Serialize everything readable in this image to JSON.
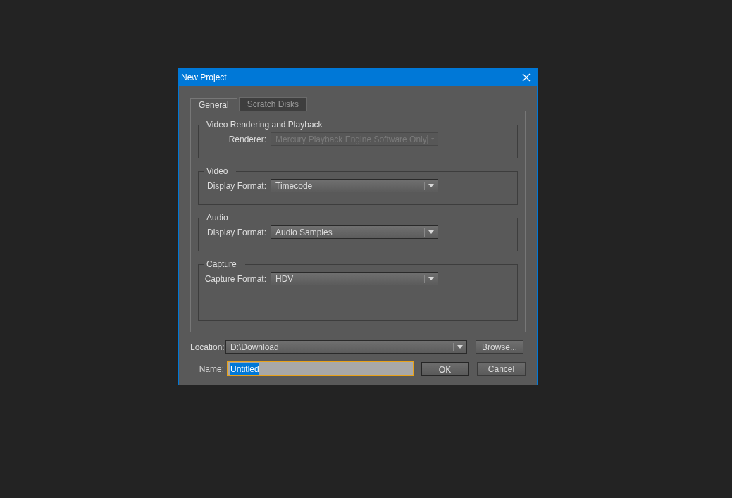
{
  "window": {
    "title": "New Project"
  },
  "tabs": [
    {
      "label": "General",
      "selected": true
    },
    {
      "label": "Scratch Disks",
      "selected": false
    }
  ],
  "groups": [
    {
      "title": "Video Rendering and Playback",
      "fields": [
        {
          "label": "Renderer:",
          "value": "Mercury Playback Engine Software Only",
          "disabled": true
        }
      ]
    },
    {
      "title": "Video",
      "fields": [
        {
          "label": "Display Format:",
          "value": "Timecode",
          "disabled": false
        }
      ]
    },
    {
      "title": "Audio",
      "fields": [
        {
          "label": "Display Format:",
          "value": "Audio Samples",
          "disabled": false
        }
      ]
    },
    {
      "title": "Capture",
      "fields": [
        {
          "label": "Capture Format:",
          "value": "HDV",
          "disabled": false
        }
      ]
    }
  ],
  "location": {
    "label": "Location:",
    "value": "D:\\Download",
    "button": "Browse..."
  },
  "name": {
    "label": "Name:",
    "value": "Untitled",
    "selected": true,
    "focused": true
  },
  "buttons": [
    {
      "label": "OK",
      "default": true
    },
    {
      "label": "Cancel",
      "default": false
    }
  ]
}
